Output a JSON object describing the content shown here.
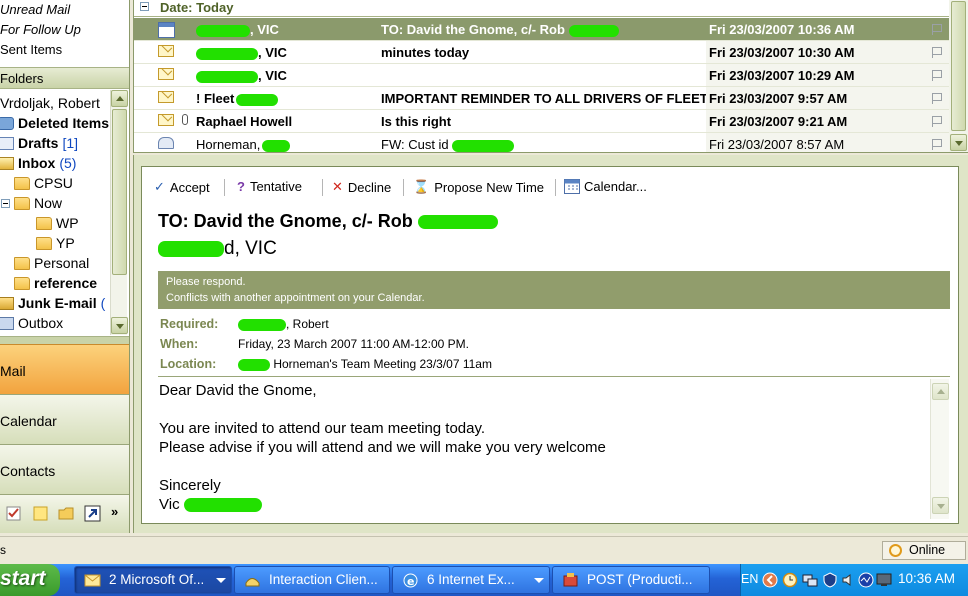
{
  "nav": {
    "links": [
      "Unread Mail",
      "For Follow Up",
      "Sent Items"
    ],
    "folders_header": "Folders",
    "mailbox": "Vrdoljak, Robert",
    "folders": [
      {
        "label": "Deleted Items",
        "count": "",
        "icon": "trash-icon"
      },
      {
        "label": "Drafts",
        "count": "[1]",
        "icon": "drafts-icon"
      },
      {
        "label": "Inbox",
        "count": "(5)",
        "icon": "inbox-icon"
      },
      {
        "label": "CPSU",
        "count": "",
        "icon": "folder-icon"
      },
      {
        "label": "Now",
        "count": "",
        "icon": "folder-icon"
      },
      {
        "label": "WP",
        "count": "",
        "icon": "folder-icon"
      },
      {
        "label": "YP",
        "count": "",
        "icon": "folder-icon"
      },
      {
        "label": "Personal",
        "count": "",
        "icon": "folder-icon"
      },
      {
        "label": "reference",
        "count": "",
        "icon": "folder-icon"
      },
      {
        "label": "Junk E-mail",
        "count": "(",
        "icon": "junk-icon"
      },
      {
        "label": "Outbox",
        "count": "",
        "icon": "outbox-icon"
      }
    ],
    "buttons": [
      "Mail",
      "Calendar",
      "Contacts"
    ],
    "shortcuts": [
      "tasks-icon",
      "notes-icon",
      "folder-list-icon",
      "shortcuts-icon"
    ],
    "more": "»"
  },
  "list": {
    "group_header": "Date: Today",
    "rows": [
      {
        "from": ", VIC",
        "subject": "TO: David the Gnome, c/- Rob",
        "date": "Fri 23/03/2007 10:36 AM",
        "icon": "meeting-request-icon",
        "bold": true,
        "selected": true,
        "attachment": false
      },
      {
        "from": ", VIC",
        "subject": "minutes today",
        "date": "Fri 23/03/2007 10:30 AM",
        "icon": "envelope-icon",
        "bold": true,
        "selected": false,
        "attachment": false
      },
      {
        "from": ", VIC",
        "subject": "",
        "date": "Fri 23/03/2007 10:29 AM",
        "icon": "envelope-icon",
        "bold": true,
        "selected": false,
        "attachment": false
      },
      {
        "from": "! Fleet",
        "subject": "IMPORTANT REMINDER TO ALL DRIVERS OF FLEET ...",
        "date": "Fri 23/03/2007 9:57 AM",
        "icon": "envelope-icon",
        "bold": true,
        "selected": false,
        "attachment": false
      },
      {
        "from": "Raphael Howell",
        "subject": "Is this right",
        "date": "Fri 23/03/2007 9:21 AM",
        "icon": "envelope-icon",
        "bold": true,
        "selected": false,
        "attachment": true
      },
      {
        "from": "Horneman,",
        "subject": "FW: Cust id",
        "date": "Fri 23/03/2007 8:57 AM",
        "icon": "opened-envelope-icon",
        "bold": false,
        "selected": false,
        "attachment": false
      }
    ]
  },
  "reading": {
    "toolbar": {
      "accept": "Accept",
      "tentative": "Tentative",
      "decline": "Decline",
      "propose": "Propose New Time",
      "calendar": "Calendar..."
    },
    "subject": "TO: David the Gnome, c/- Rob",
    "sender": "d, VIC",
    "infobar": {
      "line1": "Please respond.",
      "line2": "Conflicts with another appointment on your Calendar."
    },
    "required_label": "Required:",
    "required_value": ", Robert",
    "when_label": "When:",
    "when_value": "Friday, 23 March 2007 11:00 AM-12:00 PM.",
    "location_label": "Location:",
    "location_value": "Horneman's Team Meeting 23/3/07 11am",
    "body": {
      "greeting": "Dear David the Gnome,",
      "line1": "You are invited to attend our team meeting today.",
      "line2": "Please advise if you will attend and we will make you very welcome",
      "closing": "Sincerely",
      "signature": "Vic"
    }
  },
  "status": {
    "left": "s",
    "online": "Online"
  },
  "taskbar": {
    "start": "start",
    "tasks": [
      {
        "label": "2 Microsoft Of...",
        "icon": "outlook-icon",
        "active": true,
        "group": true
      },
      {
        "label": "Interaction Clien...",
        "icon": "phone-icon",
        "active": false,
        "group": false
      },
      {
        "label": "6 Internet Ex...",
        "icon": "internet-explorer-icon",
        "active": false,
        "group": true
      },
      {
        "label": "POST (Producti...",
        "icon": "app-icon",
        "active": false,
        "group": false
      }
    ],
    "lang": "EN",
    "clock": "10:36 AM"
  },
  "colors": {
    "selection": "#8b9a6c",
    "header_green": "#4f6228",
    "label_green": "#7b8751",
    "mail_orange": "#f2a33e",
    "redaction": "#22e000",
    "taskbar_blue": "#2463d6",
    "start_green": "#3a9a2b"
  }
}
